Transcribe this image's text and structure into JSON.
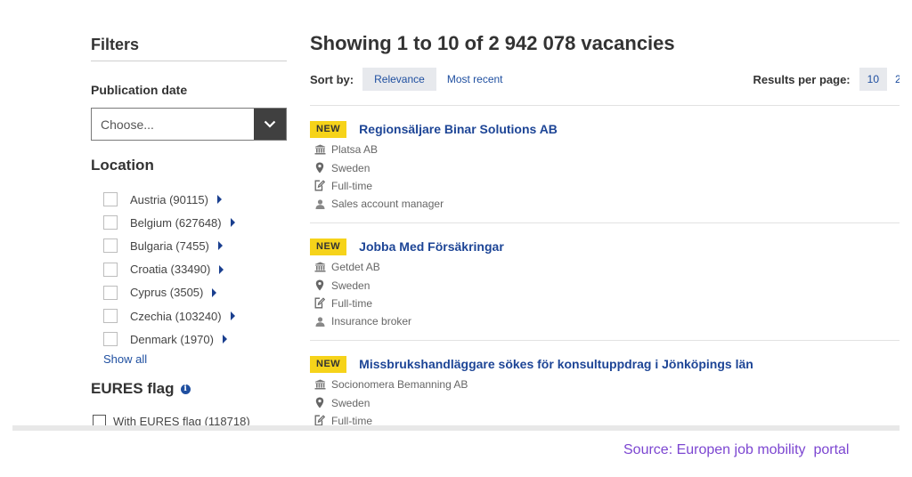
{
  "sidebar": {
    "filters_title": "Filters",
    "publication_date_label": "Publication date",
    "publication_date_placeholder": "Choose...",
    "location_title": "Location",
    "locations": [
      {
        "label": "Austria (90115)"
      },
      {
        "label": "Belgium (627648)"
      },
      {
        "label": "Bulgaria (7455)"
      },
      {
        "label": "Croatia (33490)"
      },
      {
        "label": "Cyprus (3505)"
      },
      {
        "label": "Czechia (103240)"
      },
      {
        "label": "Denmark (1970)"
      }
    ],
    "show_all": "Show all",
    "eures_title": "EURES flag",
    "eures_option": "With EURES flag (118718)"
  },
  "main": {
    "heading": "Showing 1 to 10 of 2 942 078 vacancies",
    "sort_label": "Sort by:",
    "sort_options": [
      "Relevance",
      "Most recent"
    ],
    "sort_active": "Relevance",
    "results_per_page_label": "Results per page:",
    "results_per_page_options": [
      "10",
      "2"
    ],
    "results_per_page_active": "10"
  },
  "jobs": [
    {
      "badge": "NEW",
      "title": "Regionsäljare Binar Solutions AB",
      "employer": "Platsa AB",
      "location": "Sweden",
      "type": "Full-time",
      "occupation": "Sales account manager"
    },
    {
      "badge": "NEW",
      "title": "Jobba Med Försäkringar",
      "employer": "Getdet AB",
      "location": "Sweden",
      "type": "Full-time",
      "occupation": "Insurance broker"
    },
    {
      "badge": "NEW",
      "title": "Missbrukshandläggare sökes för konsultuppdrag i Jönköpings län",
      "employer": "Socionomera Bemanning AB",
      "location": "Sweden",
      "type": "Full-time"
    }
  ],
  "source_caption": "Source: Europen job mobility  portal",
  "colors": {
    "link": "#1d4596",
    "badge": "#f6d31a",
    "caption": "#7c46d1",
    "select_arrow_bg": "#404040"
  },
  "icons": {
    "employer": "building-icon",
    "location": "map-pin-icon",
    "type": "document-edit-icon",
    "occupation": "person-icon"
  }
}
